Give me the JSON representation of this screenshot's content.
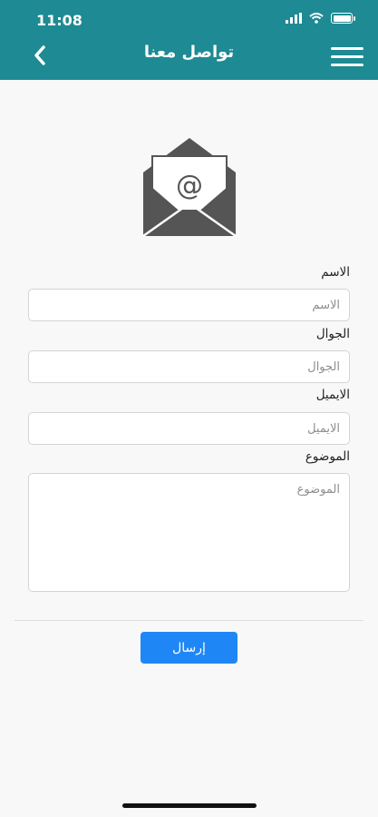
{
  "status_bar": {
    "time": "11:08"
  },
  "header": {
    "title": "تواصل معنا"
  },
  "form": {
    "name": {
      "label": "الاسم",
      "placeholder": "الاسم",
      "value": ""
    },
    "phone": {
      "label": "الجوال",
      "placeholder": "الجوال",
      "value": ""
    },
    "email": {
      "label": "الايميل",
      "placeholder": "الايميل",
      "value": ""
    },
    "subject": {
      "label": "الموضوع",
      "placeholder": "الموضوع",
      "value": ""
    },
    "submit_label": "إرسال"
  },
  "icons": {
    "back": "chevron-left-icon",
    "menu": "hamburger-menu-icon",
    "hero": "envelope-at-icon",
    "signal": "signal-icon",
    "wifi": "wifi-icon",
    "battery": "battery-icon"
  },
  "colors": {
    "header": "#1e8a93",
    "primary_button": "#1f87f5",
    "background": "#f8f8f8",
    "envelope": "#555555"
  }
}
